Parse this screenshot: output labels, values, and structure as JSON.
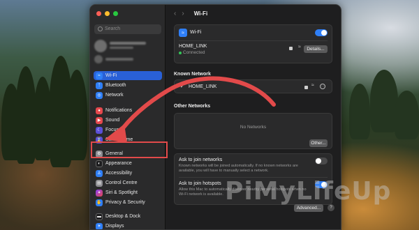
{
  "window": {
    "title": "Wi-Fi"
  },
  "sidebar": {
    "search_placeholder": "Search",
    "items": [
      {
        "label": "Wi-Fi",
        "icon": "wifi-icon",
        "color": "#2f7ff7",
        "selected": true
      },
      {
        "label": "Bluetooth",
        "icon": "bluetooth-icon",
        "color": "#2f7ff7"
      },
      {
        "label": "Network",
        "icon": "globe-icon",
        "color": "#2f7ff7"
      },
      {
        "label": "Notifications",
        "icon": "bell-icon",
        "color": "#e5484d"
      },
      {
        "label": "Sound",
        "icon": "speaker-icon",
        "color": "#e5484d"
      },
      {
        "label": "Focus",
        "icon": "moon-icon",
        "color": "#5b4fd8"
      },
      {
        "label": "Screen Time",
        "icon": "hourglass-icon",
        "color": "#5b4fd8"
      },
      {
        "label": "General",
        "icon": "gear-icon",
        "color": "#8e8e93"
      },
      {
        "label": "Appearance",
        "icon": "appearance-icon",
        "color": "#1c1c1e"
      },
      {
        "label": "Accessibility",
        "icon": "accessibility-icon",
        "color": "#2f7ff7"
      },
      {
        "label": "Control Centre",
        "icon": "control-centre-icon",
        "color": "#8e8e93"
      },
      {
        "label": "Siri & Spotlight",
        "icon": "siri-icon",
        "color": "#8a3ffc"
      },
      {
        "label": "Privacy & Security",
        "icon": "hand-icon",
        "color": "#2f7ff7"
      },
      {
        "label": "Desktop & Dock",
        "icon": "dock-icon",
        "color": "#1c1c1e"
      },
      {
        "label": "Displays",
        "icon": "display-icon",
        "color": "#2f7ff7"
      }
    ]
  },
  "wifi": {
    "label": "Wi-Fi",
    "enabled": true,
    "current_network": "HOME_LINK",
    "status": "Connected",
    "details_button": "Details..."
  },
  "known": {
    "heading": "Known Network",
    "network": "HOME_LINK"
  },
  "other": {
    "heading": "Other Networks",
    "empty_text": "No Networks",
    "other_button": "Other..."
  },
  "ask_join_networks": {
    "title": "Ask to join networks",
    "desc_line1": "Known networks will be joined automatically. If no known networks are",
    "desc_line2": "available, you will have to manually select a network.",
    "enabled": false
  },
  "ask_join_hotspots": {
    "title": "Ask to join hotspots",
    "desc_line1": "Allow this Mac to automatically discover nearby personal hotspots when no",
    "desc_line2": "Wi-Fi network is available.",
    "enabled": true
  },
  "footer": {
    "advanced_button": "Advanced...",
    "help": "?"
  },
  "watermark": "PiMyLifeUp",
  "colors": {
    "accent": "#2f7ff7",
    "selected": "#2960d6",
    "callout": "#e24a4a"
  }
}
